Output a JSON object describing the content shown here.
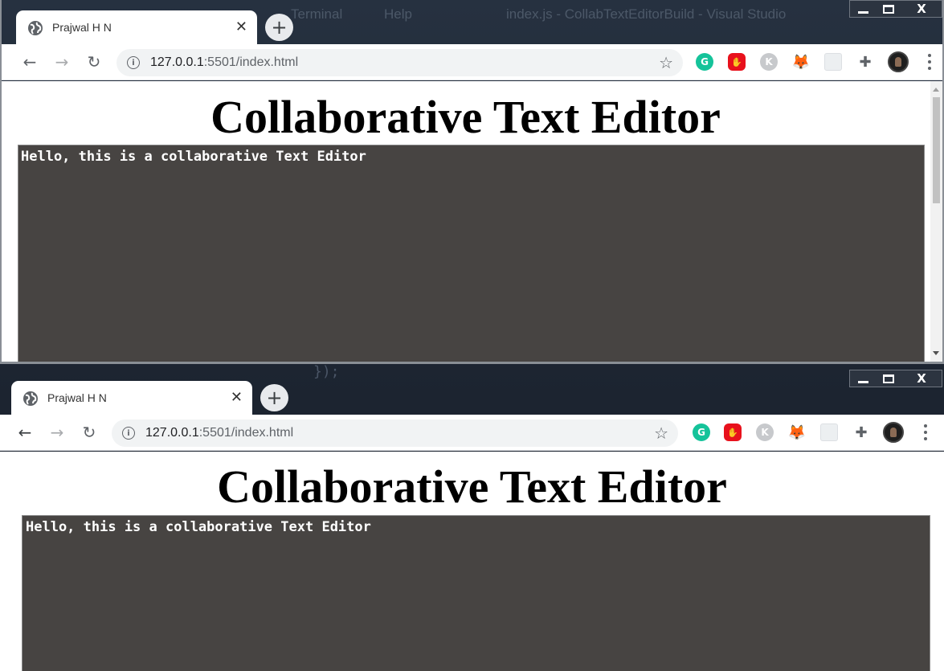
{
  "background": {
    "vscode_menu": [
      "Terminal",
      "Help"
    ],
    "vscode_window_title": "index.js - CollabTextEditorBuild - Visual Studio",
    "code_fragment": "});"
  },
  "windows": [
    {
      "tab": {
        "title": "Prajwal H N",
        "close": "✕",
        "new_tab": "+"
      },
      "caption": {
        "minimize": "",
        "maximize": "",
        "close": "X"
      },
      "address": {
        "host": "127.0.0.1",
        "rest": ":5501/index.html"
      },
      "extensions": [
        "grammarly-icon",
        "adblock-icon",
        "k-icon",
        "metamask-fox-icon",
        "blank-extension-icon",
        "puzzle-icon",
        "profile-avatar"
      ],
      "page": {
        "title": "Collaborative Text Editor",
        "editor_text": "Hello, this is a collaborative Text Editor"
      }
    },
    {
      "tab": {
        "title": "Prajwal H N",
        "close": "✕",
        "new_tab": "+"
      },
      "caption": {
        "minimize": "",
        "maximize": "",
        "close": "X"
      },
      "address": {
        "host": "127.0.0.1",
        "rest": ":5501/index.html"
      },
      "extensions": [
        "grammarly-icon",
        "adblock-icon",
        "k-icon",
        "metamask-fox-icon",
        "blank-extension-icon",
        "puzzle-icon",
        "profile-avatar"
      ],
      "page": {
        "title": "Collaborative Text Editor",
        "editor_text": "Hello, this is a collaborative Text Editor"
      }
    }
  ],
  "colors": {
    "editor_bg": "#474442",
    "editor_text": "#ffffff",
    "grammarly": "#15c39a",
    "adblock": "#e8111c",
    "metamask": "#f6851b"
  }
}
